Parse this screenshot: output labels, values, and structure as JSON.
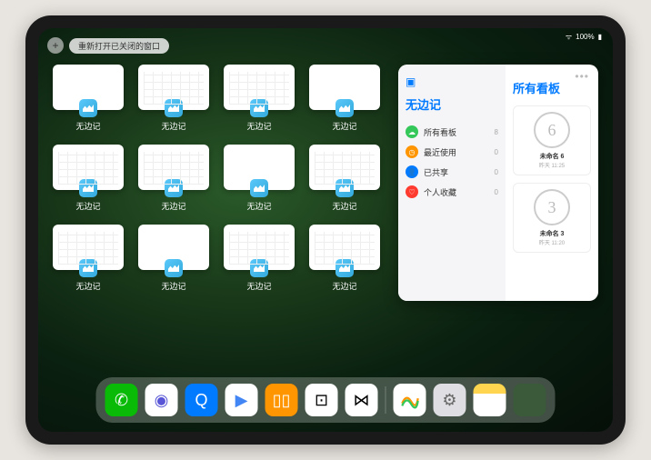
{
  "status": {
    "battery": "100%"
  },
  "top": {
    "plus": "+",
    "reopen_label": "重新打开已关闭的窗口"
  },
  "thumbs": {
    "app_label": "无边记",
    "items": [
      {
        "variant": "blank"
      },
      {
        "variant": "cal"
      },
      {
        "variant": "cal"
      },
      {
        "variant": "blank"
      },
      {
        "variant": "cal"
      },
      {
        "variant": "cal"
      },
      {
        "variant": "blank"
      },
      {
        "variant": "cal"
      },
      {
        "variant": "cal"
      },
      {
        "variant": "blank"
      },
      {
        "variant": "cal"
      },
      {
        "variant": "cal"
      }
    ]
  },
  "panel": {
    "sidebar_title": "无边记",
    "sidebar_items": [
      {
        "icon": "☁",
        "color": "#34c759",
        "label": "所有看板",
        "count": "8"
      },
      {
        "icon": "◷",
        "color": "#ff9500",
        "label": "最近使用",
        "count": "0"
      },
      {
        "icon": "👤",
        "color": "#007aff",
        "label": "已共享",
        "count": "0"
      },
      {
        "icon": "♡",
        "color": "#ff3b30",
        "label": "个人收藏",
        "count": "0"
      }
    ],
    "right_title": "所有看板",
    "boards": [
      {
        "sketch": "6",
        "name": "未命名 6",
        "date": "昨天 11:25"
      },
      {
        "sketch": "3",
        "name": "未命名 3",
        "date": "昨天 11:20"
      }
    ]
  },
  "dock": {
    "icons": [
      {
        "name": "wechat",
        "bg": "#09bb07",
        "glyph": "✆"
      },
      {
        "name": "quark",
        "bg": "#ffffff",
        "glyph": "◉",
        "fg": "#5856d6"
      },
      {
        "name": "browser-hd",
        "bg": "#007aff",
        "glyph": "Q"
      },
      {
        "name": "play",
        "bg": "#ffffff",
        "glyph": "▶",
        "fg": "#4285f4"
      },
      {
        "name": "books",
        "bg": "#ff9500",
        "glyph": "▯▯",
        "fg": "#fff"
      },
      {
        "name": "dot-square",
        "bg": "#ffffff",
        "glyph": "⊡",
        "fg": "#000"
      },
      {
        "name": "connect",
        "bg": "#ffffff",
        "glyph": "⋈",
        "fg": "#000"
      }
    ],
    "recent": [
      {
        "name": "freeform",
        "bg": "#ffffff"
      },
      {
        "name": "settings",
        "bg": "#dedee3",
        "glyph": "⚙",
        "fg": "#666"
      },
      {
        "name": "notes",
        "bg": "#fff"
      },
      {
        "name": "app-library",
        "bg": "#3a5a3a"
      }
    ]
  }
}
